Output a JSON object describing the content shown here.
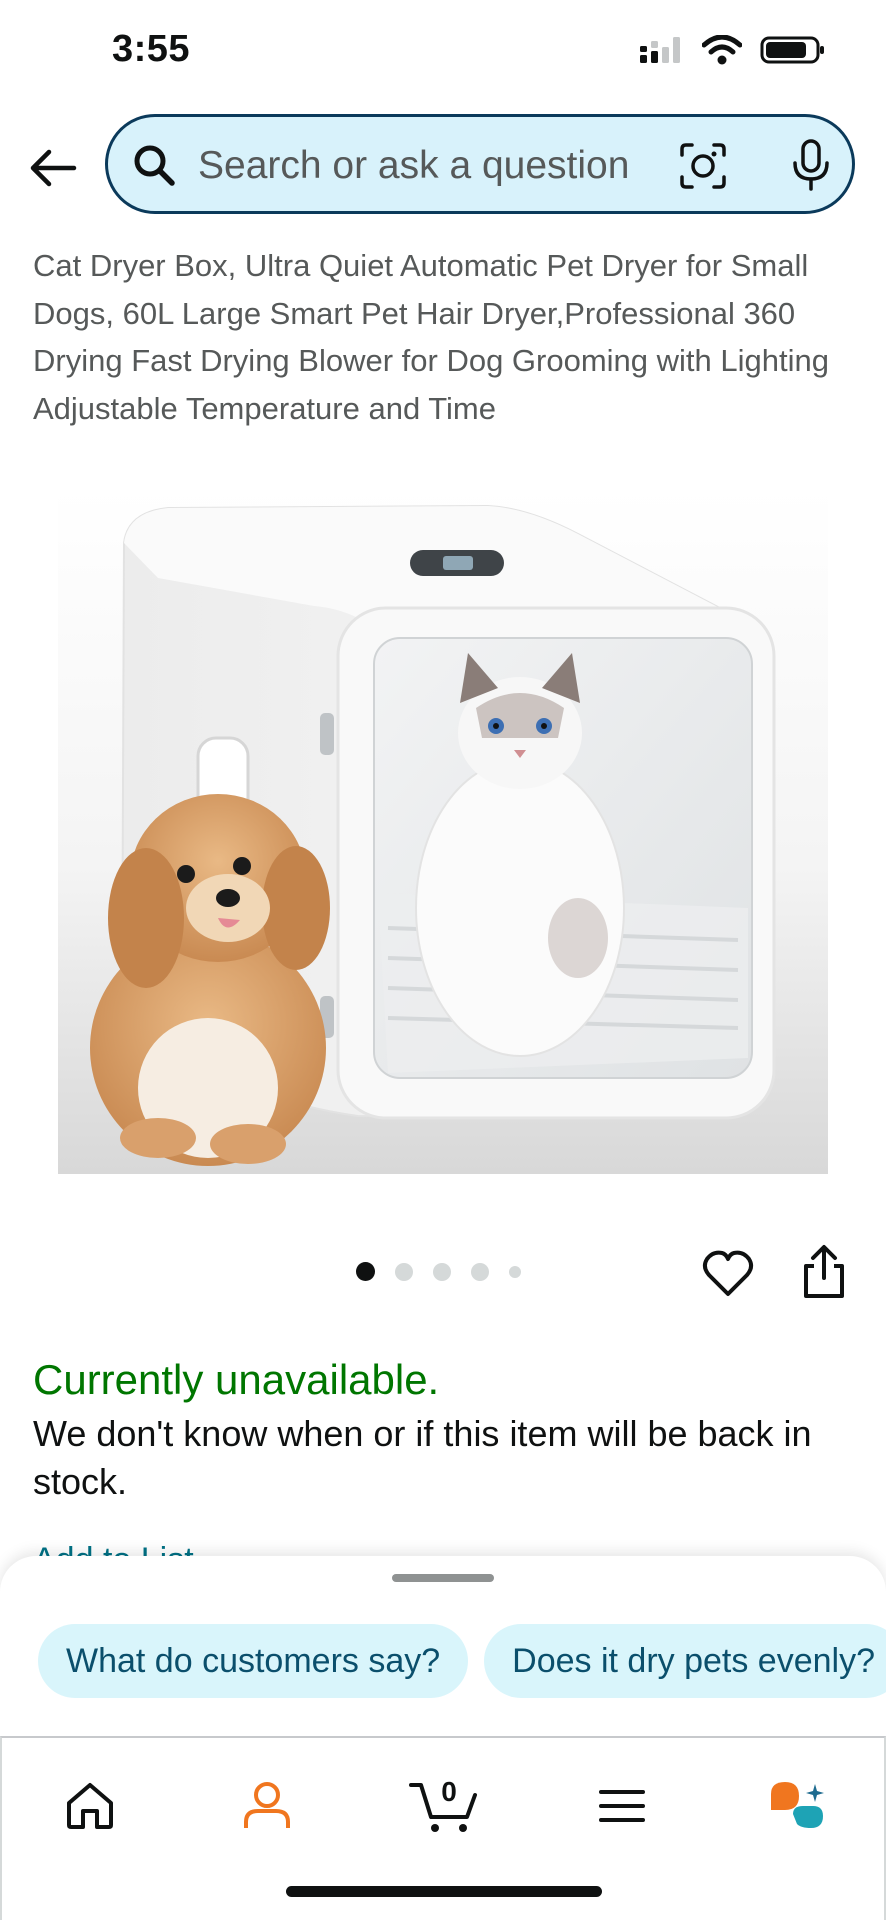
{
  "status_bar": {
    "time": "3:55"
  },
  "search": {
    "placeholder": "Search or ask a question"
  },
  "product": {
    "title": "Cat Dryer Box, Ultra Quiet Automatic Pet Dryer for Small Dogs, 60L Large Smart Pet Hair Dryer,Professional 360 Drying Fast Drying Blower for Dog Grooming with Lighting Adjustable Temperature and Time",
    "image_count": 5,
    "active_image": 1
  },
  "availability": {
    "status": "Currently unavailable.",
    "message": "We don't know when or if this item will be back in stock.",
    "add_to_list": "Add to List"
  },
  "suggestions": [
    "What do customers say?",
    "Does it dry pets evenly?"
  ],
  "nav": {
    "items": [
      "home-icon",
      "account-icon",
      "cart-icon",
      "menu-icon",
      "rufus-icon"
    ],
    "cart_count": "0",
    "active": "account-icon"
  },
  "colors": {
    "availability_green": "#007600",
    "search_border": "#0b3a5b",
    "search_bg": "#d8f2fb",
    "chip_bg": "#d9f5fb",
    "accent_orange": "#f0761f",
    "rufus_teal": "#1ea3b5"
  }
}
